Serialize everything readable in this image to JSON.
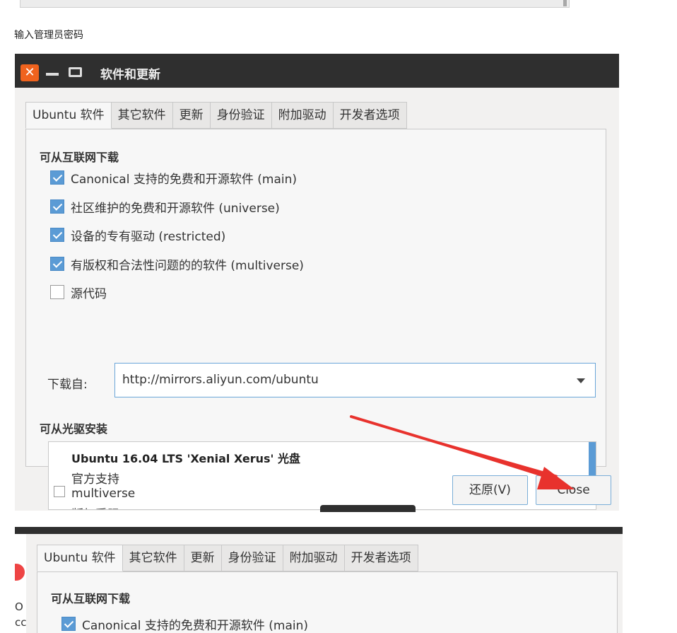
{
  "caption": "输入管理员密码",
  "window": {
    "title": "软件和更新",
    "close_glyph": "✕",
    "tabs": [
      {
        "label": "Ubuntu 软件",
        "active": true
      },
      {
        "label": "其它软件"
      },
      {
        "label": "更新"
      },
      {
        "label": "身份验证"
      },
      {
        "label": "附加驱动"
      },
      {
        "label": "开发者选项"
      }
    ],
    "internet_section": "可从互联网下载",
    "options": [
      {
        "label": "Canonical 支持的免费和开源软件 (main)",
        "checked": true
      },
      {
        "label": "社区维护的免费和开源软件 (universe)",
        "checked": true
      },
      {
        "label": "设备的专有驱动 (restricted)",
        "checked": true
      },
      {
        "label": "有版权和合法性问题的的软件 (multiverse)",
        "checked": true
      },
      {
        "label": "源代码",
        "checked": false
      }
    ],
    "download_from_label": "下载自:",
    "download_from_value": "http://mirrors.aliyun.com/ubuntu",
    "cdrom_section": "可从光驱安装",
    "cdrom": {
      "title": "Ubuntu 16.04 LTS 'Xenial Xerus' 光盘",
      "lines": [
        "官方支持",
        "multiverse",
        "版权受限"
      ]
    },
    "buttons": {
      "revert": "还原(V)",
      "close": "Close"
    }
  },
  "window2": {
    "tabs": [
      "Ubuntu 软件",
      "其它软件",
      "更新",
      "身份验证",
      "附加驱动",
      "开发者选项"
    ],
    "internet_section": "可从互联网下载",
    "first_option": "Canonical 支持的免费和开源软件 (main)",
    "left_fragments": [
      "O",
      "cc"
    ]
  },
  "colors": {
    "titlebar": "#2f2f2f",
    "close_button": "#f0631e",
    "checkbox_checked": "#5b9bd5",
    "annotation_arrow": "#e8322d"
  }
}
